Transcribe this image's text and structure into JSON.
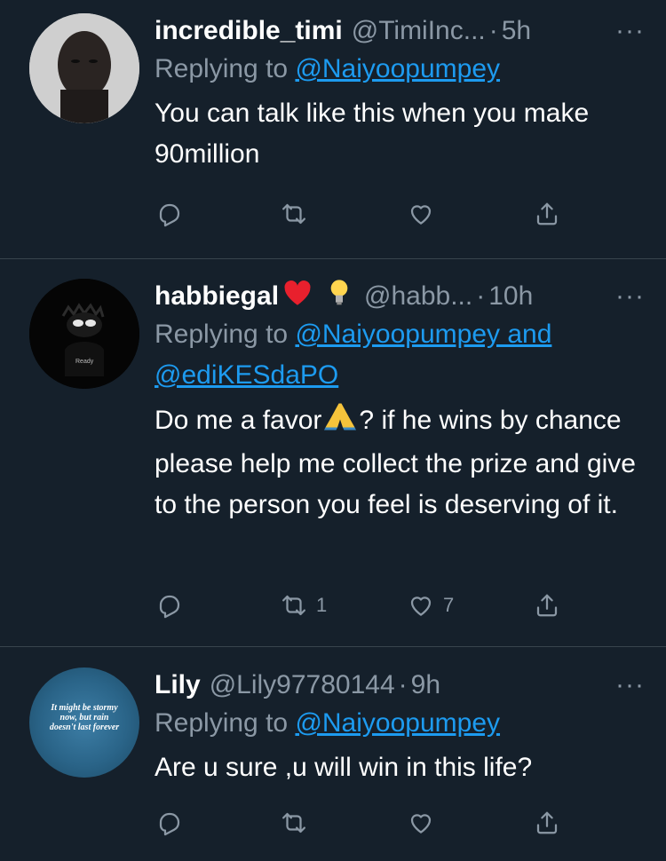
{
  "tweets": [
    {
      "name": "incredible_timi",
      "handle": "@TimiInc...",
      "dot": "·",
      "time": "5h",
      "replying_prefix": "Replying to ",
      "replying_to": "@Naiyoopumpey",
      "text": "You can talk like this when you make 90million",
      "retweets": "",
      "likes": ""
    },
    {
      "name": "habbiegal",
      "handle": "@habb...",
      "dot": "·",
      "time": "10h",
      "replying_prefix": "Replying to ",
      "replying_to": "@Naiyoopumpey and @ediKESdaPO",
      "text_before_emoji": "Do me a favor",
      "text_after_emoji": "? if he wins by chance please help me collect the prize and give to the person you feel is deserving of it.",
      "retweets": "1",
      "likes": "7"
    },
    {
      "name": "Lily",
      "handle": "@Lily97780144",
      "dot": "·",
      "time": "9h",
      "replying_prefix": "Replying to ",
      "replying_to": "@Naiyoopumpey",
      "text": "Are u sure ,u will win in this life?",
      "retweets": "",
      "likes": "",
      "avatar_text": "It might be stormy now, but rain doesn't last forever"
    }
  ],
  "more_label": "···",
  "colors": {
    "bg": "#15202b",
    "muted": "#8b98a5",
    "link": "#1d9bf0",
    "divider": "#38444d"
  }
}
